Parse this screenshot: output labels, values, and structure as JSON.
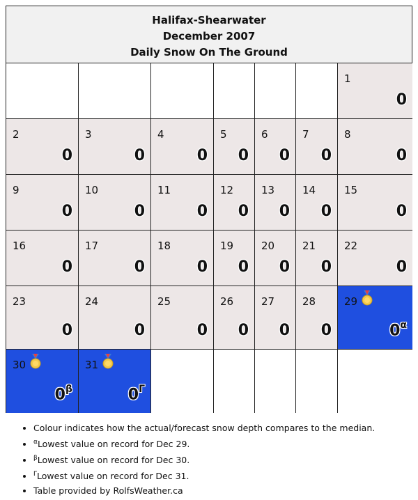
{
  "header": {
    "station": "Halifax-Shearwater",
    "month": "December 2007",
    "metric": "Daily Snow On The Ground"
  },
  "colors": {
    "normal": "#ede7e7",
    "low": "#1f4fe0",
    "empty": "#ffffff"
  },
  "days": [
    {
      "day": "1",
      "value": "0"
    },
    {
      "day": "2",
      "value": "0"
    },
    {
      "day": "3",
      "value": "0"
    },
    {
      "day": "4",
      "value": "0"
    },
    {
      "day": "5",
      "value": "0"
    },
    {
      "day": "6",
      "value": "0"
    },
    {
      "day": "7",
      "value": "0"
    },
    {
      "day": "8",
      "value": "0"
    },
    {
      "day": "9",
      "value": "0"
    },
    {
      "day": "10",
      "value": "0"
    },
    {
      "day": "11",
      "value": "0"
    },
    {
      "day": "12",
      "value": "0"
    },
    {
      "day": "13",
      "value": "0"
    },
    {
      "day": "14",
      "value": "0"
    },
    {
      "day": "15",
      "value": "0"
    },
    {
      "day": "16",
      "value": "0"
    },
    {
      "day": "17",
      "value": "0"
    },
    {
      "day": "18",
      "value": "0"
    },
    {
      "day": "19",
      "value": "0"
    },
    {
      "day": "20",
      "value": "0"
    },
    {
      "day": "21",
      "value": "0"
    },
    {
      "day": "22",
      "value": "0"
    },
    {
      "day": "23",
      "value": "0"
    },
    {
      "day": "24",
      "value": "0"
    },
    {
      "day": "25",
      "value": "0"
    },
    {
      "day": "26",
      "value": "0"
    },
    {
      "day": "27",
      "value": "0"
    },
    {
      "day": "28",
      "value": "0"
    },
    {
      "day": "29",
      "value": "0",
      "note": "α",
      "status": "low",
      "medal": "medal-icon"
    },
    {
      "day": "30",
      "value": "0",
      "note": "β",
      "status": "low",
      "medal": "medal-icon"
    },
    {
      "day": "31",
      "value": "0",
      "note": "Γ",
      "status": "low",
      "medal": "medal-icon"
    }
  ],
  "notes": {
    "colour": "Colour indicates how the actual/forecast snow depth compares to the median.",
    "alpha_mark": "α",
    "alpha_text": "Lowest value on record for Dec 29.",
    "beta_mark": "β",
    "beta_text": "Lowest value on record for Dec 30.",
    "gamma_mark": "Γ",
    "gamma_text": "Lowest value on record for Dec 31.",
    "provider": "Table provided by RolfsWeather.ca"
  }
}
